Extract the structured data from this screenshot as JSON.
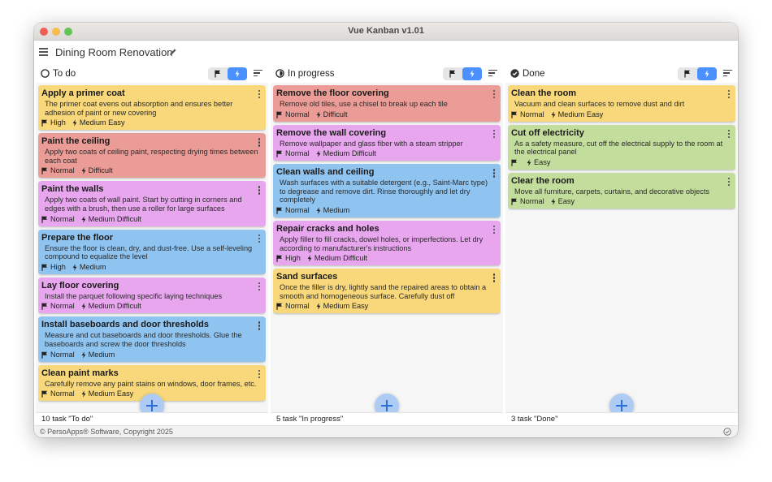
{
  "window": {
    "title": "Vue Kanban v1.01"
  },
  "header": {
    "board_title": "Dining Room Renovation"
  },
  "colors": {
    "yellow": "#f8d87a",
    "red": "#ec9c96",
    "purple": "#e7a6ee",
    "blue": "#8fc4f1",
    "green": "#c3de9c",
    "accent": "#4a90ff"
  },
  "columns": [
    {
      "title": "To do",
      "status_icon": "circle-outline-icon",
      "count_text": "10 task \"To do\"",
      "cards": [
        {
          "title": "Apply a primer coat",
          "description": "The primer coat evens out absorption and ensures better adhesion of paint or new covering",
          "priority": "High",
          "difficulty": "Medium Easy",
          "color": "yellow"
        },
        {
          "title": "Paint the ceiling",
          "description": "Apply two coats of ceiling paint, respecting drying times between each coat",
          "priority": "Normal",
          "difficulty": "Difficult",
          "color": "red"
        },
        {
          "title": "Paint the walls",
          "description": "Apply two coats of wall paint. Start by cutting in corners and edges with a brush, then use a roller for large surfaces",
          "priority": "Normal",
          "difficulty": "Medium Difficult",
          "color": "purple"
        },
        {
          "title": "Prepare the floor",
          "description": "Ensure the floor is clean, dry, and dust-free. Use a self-leveling compound to equalize the level",
          "priority": "High",
          "difficulty": "Medium",
          "color": "blue"
        },
        {
          "title": "Lay floor covering",
          "description": "Install the parquet following specific laying techniques",
          "priority": "Normal",
          "difficulty": "Medium Difficult",
          "color": "purple"
        },
        {
          "title": "Install baseboards and door thresholds",
          "description": "Measure and cut baseboards and door thresholds. Glue the baseboards and screw the door thresholds",
          "priority": "Normal",
          "difficulty": "Medium",
          "color": "blue"
        },
        {
          "title": "Clean paint marks",
          "description": "Carefully remove any paint stains on windows, door frames, etc.",
          "priority": "Normal",
          "difficulty": "Medium Easy",
          "color": "yellow"
        }
      ]
    },
    {
      "title": "In progress",
      "status_icon": "half-circle-icon",
      "count_text": "5 task \"In progress\"",
      "cards": [
        {
          "title": "Remove the floor covering",
          "description": "Remove old tiles, use a chisel to break up each tile",
          "priority": "Normal",
          "difficulty": "Difficult",
          "color": "red"
        },
        {
          "title": "Remove the wall covering",
          "description": "Remove wallpaper and glass fiber with a steam stripper",
          "priority": "Normal",
          "difficulty": "Medium Difficult",
          "color": "purple"
        },
        {
          "title": "Clean walls and ceiling",
          "description": "Wash surfaces with a suitable detergent (e.g., Saint-Marc type) to degrease and remove dirt. Rinse thoroughly and let dry completely",
          "priority": "Normal",
          "difficulty": "Medium",
          "color": "blue"
        },
        {
          "title": "Repair cracks and holes",
          "description": "Apply filler to fill cracks, dowel holes, or imperfections. Let dry according to manufacturer's instructions",
          "priority": "High",
          "difficulty": "Medium Difficult",
          "color": "purple"
        },
        {
          "title": "Sand surfaces",
          "description": "Once the filler is dry, lightly sand the repaired areas to obtain a smooth and homogeneous surface. Carefully dust off",
          "priority": "Normal",
          "difficulty": "Medium Easy",
          "color": "yellow"
        }
      ]
    },
    {
      "title": "Done",
      "status_icon": "check-circle-icon",
      "count_text": "3 task \"Done\"",
      "cards": [
        {
          "title": "Clean the room",
          "description": "Vacuum and clean surfaces to remove dust and dirt",
          "priority": "Normal",
          "difficulty": "Medium Easy",
          "color": "yellow"
        },
        {
          "title": "Cut off electricity",
          "description": "As a safety measure, cut off the electrical supply to the room at the electrical panel",
          "priority": "",
          "difficulty": "Easy",
          "color": "green"
        },
        {
          "title": "Clear the room",
          "description": "Move all furniture, carpets, curtains, and decorative objects",
          "priority": "Normal",
          "difficulty": "Easy",
          "color": "green"
        }
      ]
    }
  ],
  "footer": {
    "copyright": "© PersoApps® Software, Copyright 2025"
  }
}
